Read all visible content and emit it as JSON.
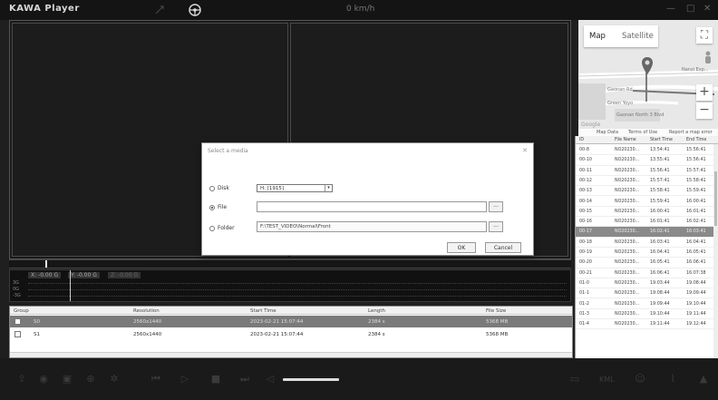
{
  "app": {
    "title": "KAWA Player",
    "speed": "0 km/h"
  },
  "graph": {
    "readouts": [
      "X: -0.00 G",
      "Y: -0.00 G",
      "Z: -0.00 G"
    ],
    "axis_labels": [
      "3G",
      "0G",
      "-3G"
    ]
  },
  "file_table": {
    "headers": [
      "Group",
      "Resolution",
      "Start Time",
      "Length",
      "File Size"
    ],
    "rows": [
      {
        "group": "S0",
        "resolution": "2560x1440",
        "start": "2023-02-21 15:07:44",
        "length": "2384 s",
        "size": "5368 MB",
        "selected": true
      },
      {
        "group": "S1",
        "resolution": "2560x1440",
        "start": "2023-02-21 15:07:44",
        "length": "2384 s",
        "size": "5368 MB",
        "selected": false
      }
    ]
  },
  "map": {
    "tab_map": "Map",
    "tab_satellite": "Satellite",
    "footer": [
      "Map Data",
      "Terms of Use",
      "Report a map error"
    ],
    "google": "Google",
    "labels": [
      "Nanzi Exp...",
      "Gaonan Rd",
      "Gaonan North 3 Blvd",
      "Green Yoyo"
    ]
  },
  "record_list": {
    "headers": [
      "ID",
      "File Name",
      "Start Time",
      "End Time"
    ],
    "rows": [
      {
        "id": "00-8",
        "name": "NO20230...",
        "start": "13:54:41",
        "end": "15:56:41"
      },
      {
        "id": "00-10",
        "name": "NO20230...",
        "start": "13:55:41",
        "end": "15:56:41"
      },
      {
        "id": "00-11",
        "name": "NO20230...",
        "start": "15:56:41",
        "end": "15:57:41"
      },
      {
        "id": "00-12",
        "name": "NO20230...",
        "start": "15:57:41",
        "end": "15:58:41"
      },
      {
        "id": "00-13",
        "name": "NO20230...",
        "start": "15:58:41",
        "end": "15:59:41"
      },
      {
        "id": "00-14",
        "name": "NO20230...",
        "start": "15:59:41",
        "end": "16:00:41"
      },
      {
        "id": "00-15",
        "name": "NO20230...",
        "start": "16:00:41",
        "end": "16:01:41"
      },
      {
        "id": "00-16",
        "name": "NO20230...",
        "start": "16:01:41",
        "end": "16:02:41"
      },
      {
        "id": "00-17",
        "name": "NO20230...",
        "start": "16:02:41",
        "end": "16:03:41"
      },
      {
        "id": "00-18",
        "name": "NO20230...",
        "start": "16:03:41",
        "end": "16:04:41"
      },
      {
        "id": "00-19",
        "name": "NO20230...",
        "start": "16:04:41",
        "end": "16:05:41"
      },
      {
        "id": "00-20",
        "name": "NO20230...",
        "start": "16:05:41",
        "end": "16:06:41"
      },
      {
        "id": "00-21",
        "name": "NO20230...",
        "start": "16:06:41",
        "end": "16:07:38"
      },
      {
        "id": "01-0",
        "name": "NO20230...",
        "start": "19:03:44",
        "end": "19:08:44"
      },
      {
        "id": "01-1",
        "name": "NO20230...",
        "start": "19:08:44",
        "end": "19:09:44"
      },
      {
        "id": "01-2",
        "name": "NO20230...",
        "start": "19:09:44",
        "end": "19:10:44"
      },
      {
        "id": "01-3",
        "name": "NO20230...",
        "start": "19:10:44",
        "end": "19:11:44"
      },
      {
        "id": "01-4",
        "name": "NO20230...",
        "start": "19:11:44",
        "end": "19:12:44"
      }
    ],
    "selected_index": 8
  },
  "dialog": {
    "title": "Select a media",
    "close": "✕",
    "disk_label": "Disk",
    "disk_value": "H:  [1915]",
    "file_label": "File",
    "file_value": "",
    "folder_label": "Folder",
    "folder_value": "F:\\TEST_VIDEO\\Normal\\Front",
    "browse": "...",
    "ok": "OK",
    "cancel": "Cancel"
  },
  "toolbar": {
    "kml": "KML"
  }
}
